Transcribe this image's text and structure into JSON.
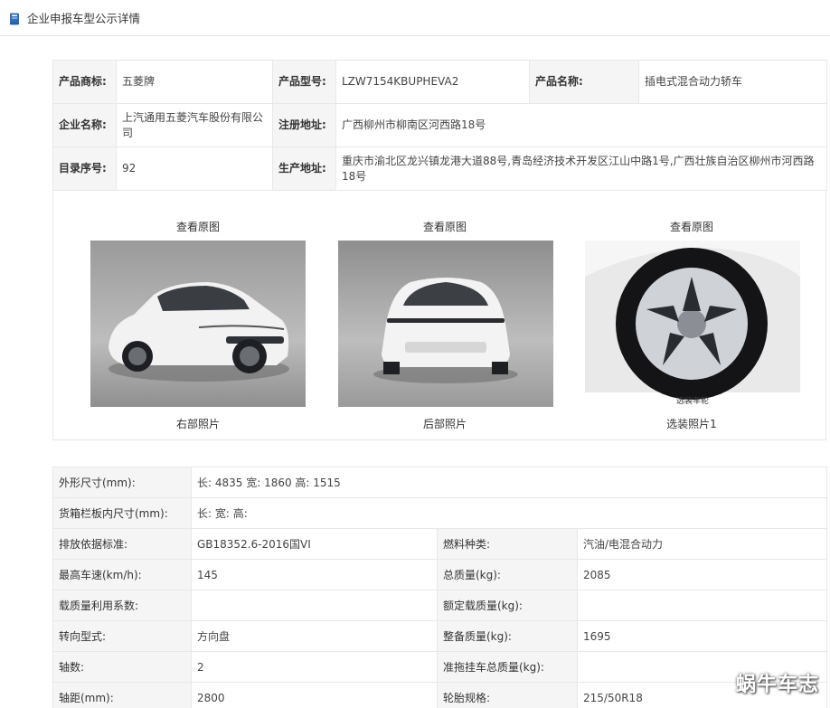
{
  "header": {
    "title": "企业申报车型公示详情"
  },
  "info": {
    "row1": {
      "label1": "产品商标:",
      "value1": "五菱牌",
      "label2": "产品型号:",
      "value2": "LZW7154KBUPHEVA2",
      "label3": "产品名称:",
      "value3": "插电式混合动力轿车"
    },
    "row2": {
      "label1": "企业名称:",
      "value1": "上汽通用五菱汽车股份有限公司",
      "label2": "注册地址:",
      "value2": "广西柳州市柳南区河西路18号"
    },
    "row3": {
      "label1": "目录序号:",
      "value1": "92",
      "label2": "生产地址:",
      "value2": "重庆市渝北区龙兴镇龙港大道88号,青岛经济技术开发区江山中路1号,广西壮族自治区柳州市河西路18号"
    }
  },
  "photos": [
    {
      "link": "查看原图",
      "caption": "右部照片"
    },
    {
      "link": "查看原图",
      "caption": "后部照片"
    },
    {
      "link": "查看原图",
      "caption": "选装照片1",
      "inner_label": "选装车轮"
    }
  ],
  "specs": {
    "dims": {
      "label": "外形尺寸(mm):",
      "value": "长: 4835 宽: 1860 高: 1515"
    },
    "cargo": {
      "label": "货箱栏板内尺寸(mm):",
      "value": "长:  宽:  高:"
    },
    "rows": [
      {
        "l1": "排放依据标准:",
        "v1": "GB18352.6-2016国VI",
        "l2": "燃料种类:",
        "v2": "汽油/电混合动力"
      },
      {
        "l1": "最高车速(km/h):",
        "v1": "145",
        "l2": "总质量(kg):",
        "v2": "2085"
      },
      {
        "l1": "载质量利用系数:",
        "v1": "",
        "l2": "额定载质量(kg):",
        "v2": ""
      },
      {
        "l1": "转向型式:",
        "v1": "方向盘",
        "l2": "整备质量(kg):",
        "v2": "1695"
      },
      {
        "l1": "轴数:",
        "v1": "2",
        "l2": "准拖挂车总质量(kg):",
        "v2": ""
      },
      {
        "l1": "轴距(mm):",
        "v1": "2800",
        "l2": "轮胎规格:",
        "v2": "215/50R18"
      }
    ]
  },
  "watermark": "蜗牛车志",
  "icons": {
    "header": "book-icon"
  }
}
